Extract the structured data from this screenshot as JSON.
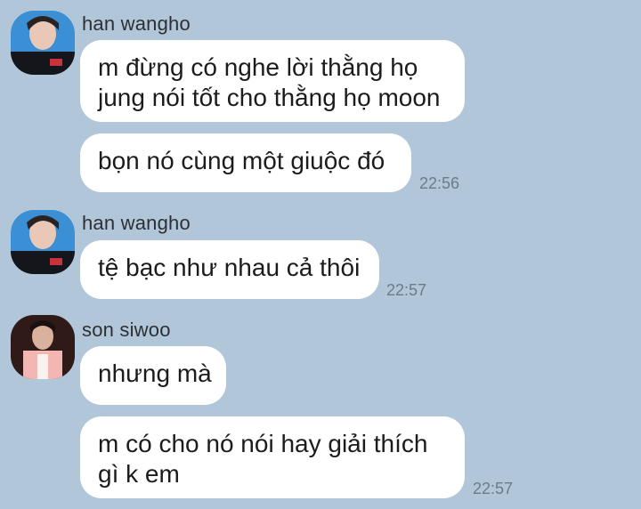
{
  "messages": [
    {
      "sender": "han wangho",
      "bubbles": [
        {
          "lines": [
            "m đừng có nghe lời thằng họ",
            "jung nói tốt cho thằng họ moon"
          ]
        },
        {
          "lines": [
            "bọn nó cùng một giuộc đó"
          ],
          "time": "22:56"
        }
      ]
    },
    {
      "sender": "han wangho",
      "bubbles": [
        {
          "lines": [
            "tệ bạc như nhau cả thôi"
          ],
          "time": "22:57"
        }
      ]
    },
    {
      "sender": "son siwoo",
      "bubbles": [
        {
          "lines": [
            "nhưng mà"
          ]
        },
        {
          "lines": [
            "m có cho nó nói hay giải thích",
            "gì k em"
          ],
          "time": "22:57"
        }
      ]
    }
  ],
  "colors": {
    "background": "#b2c6da",
    "bubble": "#ffffff",
    "text": "#1c1c1c",
    "timestamp": "#6a7b8c"
  },
  "icons": {
    "avatar_1": "profile-photo-avatar",
    "avatar_2": "profile-photo-avatar",
    "avatar_3": "profile-photo-avatar"
  }
}
